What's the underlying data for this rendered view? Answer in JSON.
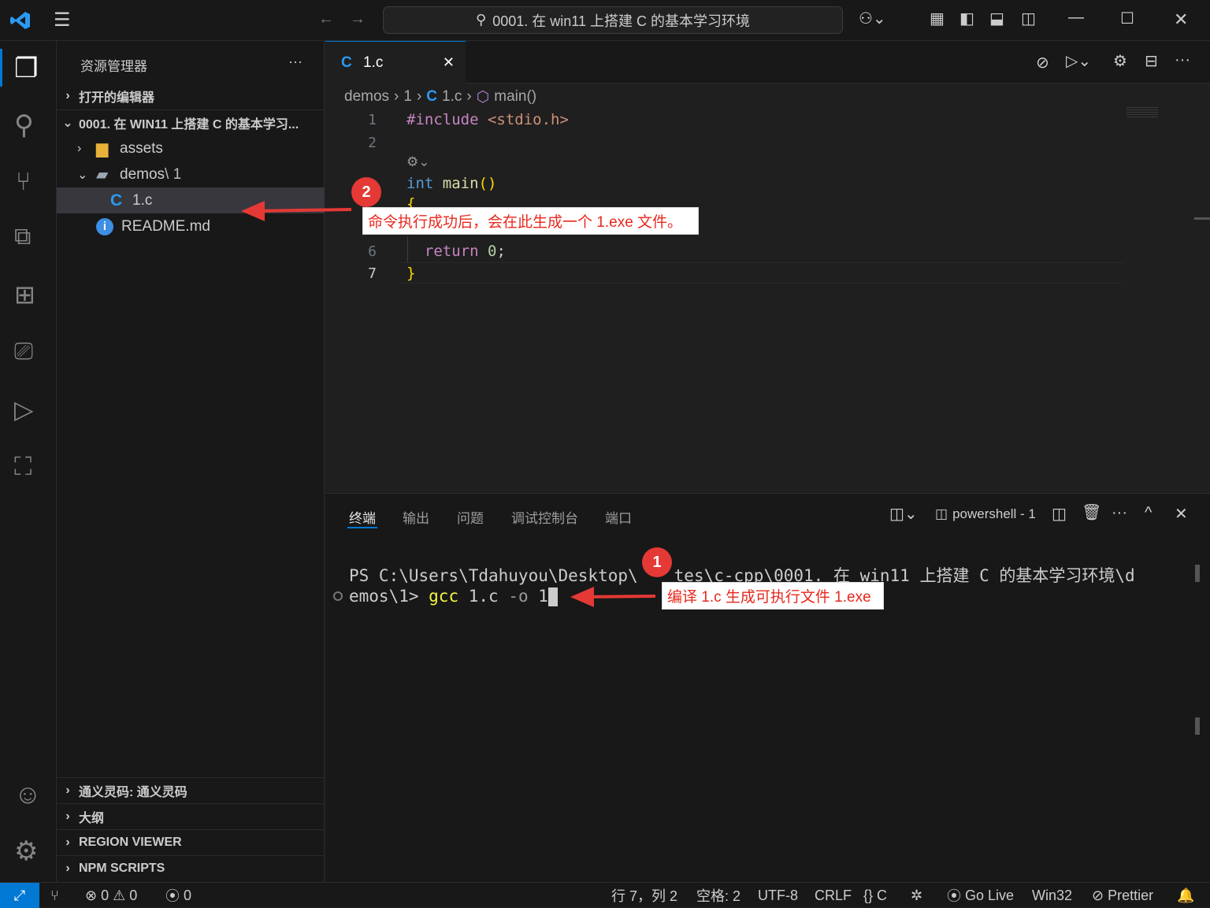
{
  "titlebar": {
    "search_text": "0001. 在 win11 上搭建 C 的基本学习环境"
  },
  "sidebar": {
    "title": "资源管理器",
    "more": "···",
    "open_editors": "打开的编辑器",
    "workspace": "0001. 在 WIN11 上搭建 C 的基本学习...",
    "items": [
      {
        "label": "assets"
      },
      {
        "label": "demos",
        "suffix": "\\ 1"
      },
      {
        "label": "1.c"
      },
      {
        "label": "README.md"
      }
    ],
    "bottom_sections": [
      "通义灵码: 通义灵码",
      "大纲",
      "REGION VIEWER",
      "NPM SCRIPTS"
    ]
  },
  "editor": {
    "tab_label": "1.c",
    "breadcrumb": [
      "demos",
      "1",
      "1.c",
      "main()"
    ],
    "line_numbers": [
      "1",
      "2",
      "6",
      "7"
    ]
  },
  "panel": {
    "tabs": [
      "终端",
      "输出",
      "问题",
      "调试控制台",
      "端口"
    ],
    "terminal_name": "powershell - 1",
    "line1": "PS C:\\Users\\Tdahuyou\\Desktop\\",
    "line1b": "tes\\c-cpp\\0001. 在 win11 上搭建 C 的基本学习环境\\d",
    "line2_prompt": "emos\\1> ",
    "line2_cmd": "gcc",
    "line2_args": " 1.c ",
    "line2_flag": "-o",
    "line2_out": " 1"
  },
  "annotations": {
    "badge1": "1",
    "callout1": "编译 1.c 生成可执行文件 1.exe",
    "badge2": "2",
    "callout2": "命令执行成功后，会在此生成一个 1.exe 文件。"
  },
  "status": {
    "errors": "0",
    "warnings": "0",
    "ports": "0",
    "position": "行 7，列 2",
    "spaces": "空格: 2",
    "encoding": "UTF-8",
    "eol": "CRLF",
    "language": "C",
    "golive": "Go Live",
    "platform": "Win32",
    "prettier": "Prettier"
  }
}
